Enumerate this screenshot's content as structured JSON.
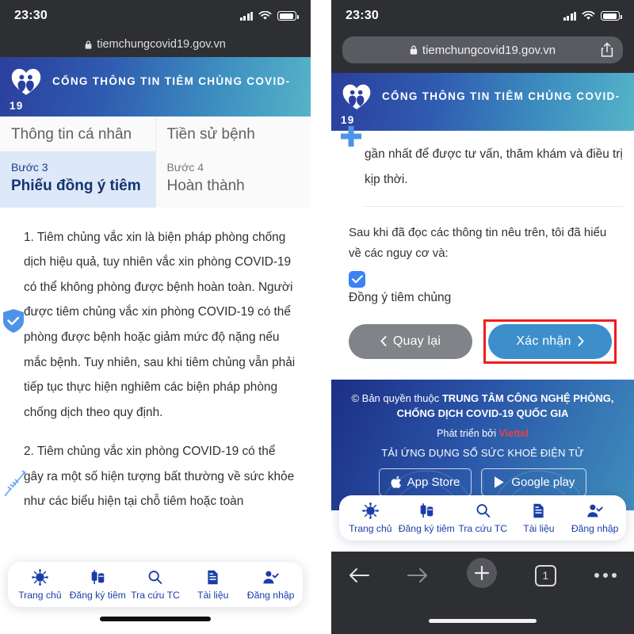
{
  "status_bar": {
    "time": "23:30",
    "signal_icon": "cellular-signal-icon",
    "wifi_icon": "wifi-icon",
    "battery_icon": "battery-icon"
  },
  "browser": {
    "url": "tiemchungcovid19.gov.vn",
    "lock_icon": "lock-icon",
    "share_icon": "share-icon",
    "back_icon": "back-arrow-icon",
    "forward_icon": "forward-arrow-icon",
    "new_tab_icon": "plus-icon",
    "tab_count": "1",
    "more_icon": "more-dots-icon"
  },
  "site_header": {
    "title_line1": "CỔNG THÔNG TIN TIÊM CHỦNG COVID-",
    "title_line2": "19",
    "logo_icon": "heart-family-logo-icon",
    "gradient_from": "#2b3f9e",
    "gradient_to": "#56b3c8"
  },
  "steps": [
    {
      "top_label": "Thông tin cá nhân",
      "number": "Bước 3",
      "name": "Phiếu đồng ý tiêm",
      "active": true
    },
    {
      "top_label": "Tiền sử bệnh",
      "number": "Bước 4",
      "name": "Hoàn thành",
      "active": false
    }
  ],
  "left_panel": {
    "paragraph_1": "1. Tiêm chủng vắc xin là biện pháp phòng chống dịch hiệu quả, tuy nhiên vắc xin phòng COVID-19 có thể không phòng được bệnh hoàn toàn. Người được tiêm chủng vắc xin phòng COVID-19 có thể phòng được bệnh hoặc giảm mức độ nặng nếu mắc bệnh. Tuy nhiên, sau khi tiêm chủng vẫn phải tiếp tục thực hiện nghiêm các biện pháp phòng chống dịch theo quy định.",
    "paragraph_2": "2. Tiêm chủng vắc xin phòng COVID-19 có thể gây ra một số hiện tượng bất thường về sức khỏe như các biểu hiện tại chỗ tiêm hoặc toàn",
    "shield_icon": "shield-check-icon",
    "syringe_icon": "syringe-icon"
  },
  "right_panel": {
    "paragraph_tail": "gần nhất để được tư vấn, thăm khám và điều trị kịp thời.",
    "cross_icon": "medical-cross-icon",
    "consent_intro": "Sau khi đã đọc các thông tin nêu trên, tôi đã hiểu về các nguy cơ và:",
    "checkbox_icon": "checkmark-icon",
    "checkbox_checked": true,
    "consent_label": "Đồng ý tiêm chủng",
    "back_button": "Quay lại",
    "back_chevron": "chevron-left-icon",
    "confirm_button": "Xác nhận",
    "confirm_chevron": "chevron-right-icon",
    "highlight_color": "#f11c1c",
    "confirm_color": "#3d8fcc",
    "back_color": "#808387"
  },
  "footer": {
    "copyright_prefix": "© Bản quyền thuộc ",
    "copyright_org_line1": "TRUNG TÂM CÔNG NGHỆ PHÒNG,",
    "copyright_org_line2": "CHỐNG DỊCH COVID-19 QUỐC GIA",
    "developed_by": "Phát triển bởi ",
    "developer": "Viettel",
    "developer_color": "#e8424a",
    "download_label": "TẢI ỨNG DỤNG SỔ SỨC KHOẺ ĐIỆN TỬ",
    "stores": [
      {
        "label": "App Store",
        "icon": "apple-icon"
      },
      {
        "label": "Google play",
        "icon": "google-play-icon"
      }
    ]
  },
  "app_nav": [
    {
      "label": "Trang chủ",
      "icon": "virus-icon"
    },
    {
      "label": "Đăng ký tiêm",
      "icon": "syringe-vial-icon"
    },
    {
      "label": "Tra cứu TC",
      "icon": "search-icon"
    },
    {
      "label": "Tài liệu",
      "icon": "document-icon"
    },
    {
      "label": "Đăng nhập",
      "icon": "user-check-icon"
    }
  ],
  "colors": {
    "nav_blue": "#1a3da8",
    "step_active_bg": "#dde8f8",
    "accent": "#3d8fcc"
  }
}
